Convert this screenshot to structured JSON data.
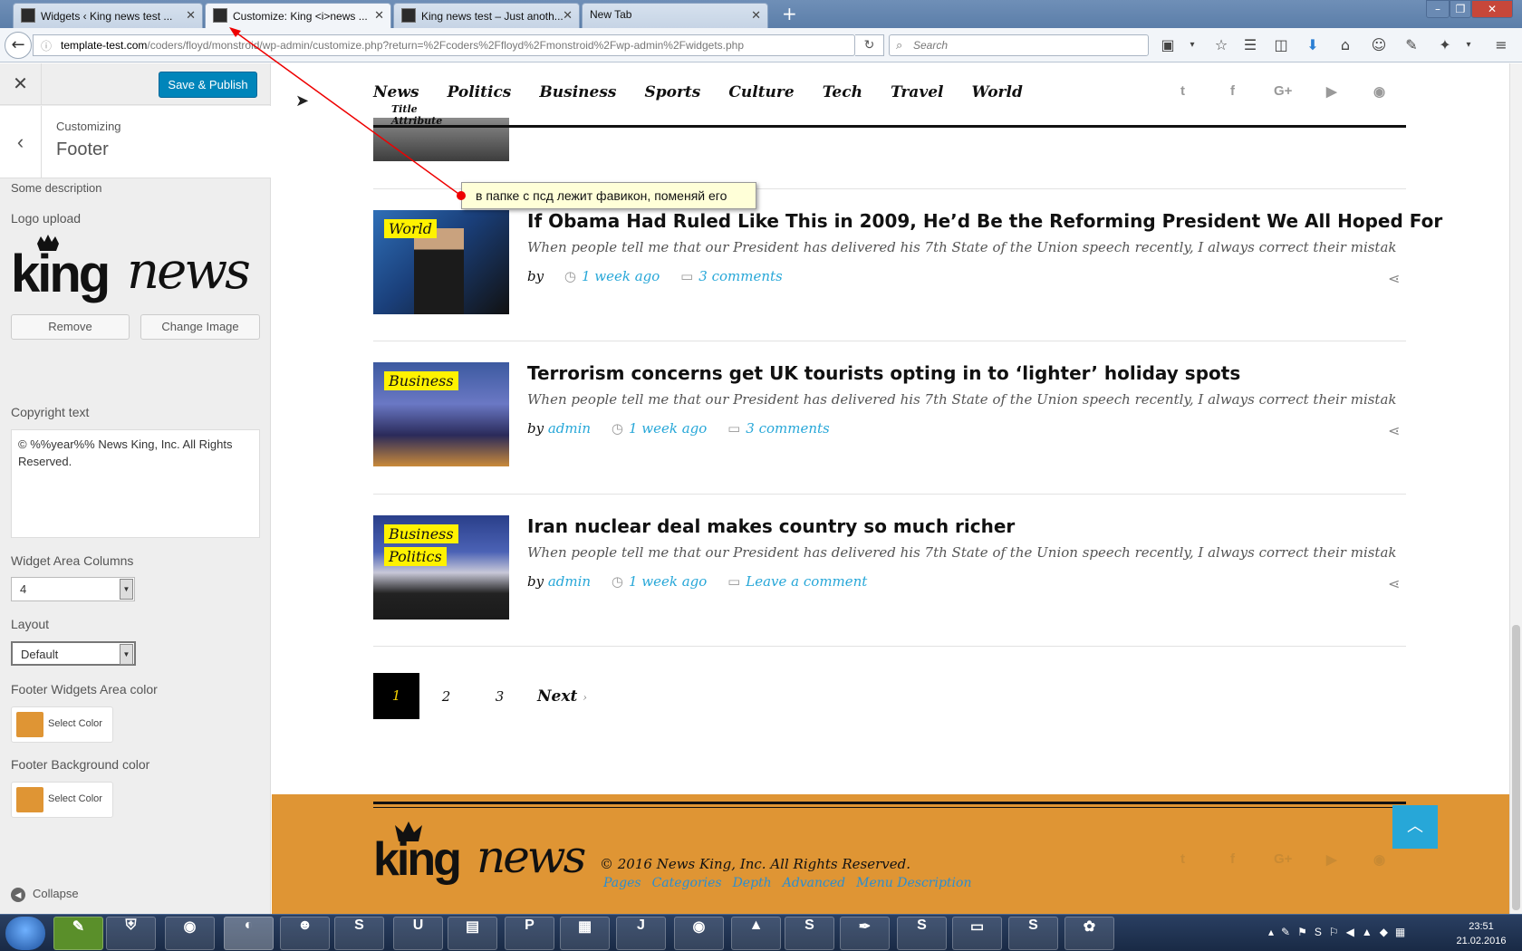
{
  "browser": {
    "tabs": [
      {
        "title": "Widgets ‹ King news test ..."
      },
      {
        "title": "Customize: King <i>news ..."
      },
      {
        "title": "King news test – Just anoth..."
      },
      {
        "title": "New Tab"
      }
    ],
    "url_domain": "template-test.com",
    "url_path": "/coders/floyd/monstroid/wp-admin/customize.php?return=%2Fcoders%2Ffloyd%2Fmonstroid%2Fwp-admin%2Fwidgets.php",
    "search_placeholder": "Search"
  },
  "customizer": {
    "publish_label": "Save & Publish",
    "customizing_label": "Customizing",
    "section_title": "Footer",
    "description": "Some description",
    "logo_label": "Logo upload",
    "logo_text_bold": "king",
    "logo_text_italic": "news",
    "remove_label": "Remove",
    "change_image_label": "Change Image",
    "copyright_label": "Copyright text",
    "copyright_value": "© %%year%% News King, Inc. All Rights Reserved.",
    "columns_label": "Widget Area Columns",
    "columns_value": "4",
    "layout_label": "Layout",
    "layout_value": "Default",
    "widgets_color_label": "Footer Widgets Area color",
    "bg_color_label": "Footer Background color",
    "select_color_label": "Select Color",
    "swatch_color": "#df9534",
    "collapse_label": "Collapse"
  },
  "site": {
    "nav": [
      "News",
      "Politics",
      "Business",
      "Sports",
      "Culture",
      "Tech",
      "Travel",
      "World"
    ],
    "title_attribute": "Title Attribute",
    "social_icons": [
      "twitter-icon",
      "facebook-icon",
      "google-plus-icon",
      "youtube-icon",
      "rss-icon"
    ],
    "social_glyphs": [
      "t",
      "f",
      "G+",
      "▶",
      "◉"
    ],
    "posts": [
      {
        "tags": [
          "World"
        ],
        "title": "If Obama Had Ruled Like This in 2009, He’d Be the Reforming President We All Hoped For",
        "excerpt": "When people tell me that our President has delivered his 7th State of the Union speech recently, I always correct their mistake and tell it...",
        "by": "by",
        "author": "",
        "time": "1 week ago",
        "comments": "3 comments"
      },
      {
        "tags": [
          "Business"
        ],
        "title": "Terrorism concerns get UK tourists opting in to ‘lighter’ holiday spots",
        "excerpt": "When people tell me that our President has delivered his 7th State of the Union speech recently, I always correct their mistake and tell it...",
        "by": "by",
        "author": "admin",
        "time": "1 week ago",
        "comments": "3 comments"
      },
      {
        "tags": [
          "Business",
          "Politics"
        ],
        "title": "Iran nuclear deal makes country so much richer",
        "excerpt": "When people tell me that our President has delivered his 7th State of the Union speech recently, I always correct their mistake and tell it...",
        "by": "by",
        "author": "admin",
        "time": "1 week ago",
        "comments": "Leave a comment"
      }
    ],
    "pagination": {
      "current": "1",
      "pages": [
        "2",
        "3"
      ],
      "next": "Next"
    },
    "footer": {
      "copyright": "© 2016 News King, Inc. All Rights Reserved.",
      "links": [
        "Pages",
        "Categories",
        "Depth",
        "Advanced",
        "Menu Description"
      ]
    }
  },
  "annotation": {
    "note": "в папке с псд лежит фавикон, поменяй его"
  },
  "taskbar": {
    "time": "23:51",
    "date": "21.02.2016"
  }
}
